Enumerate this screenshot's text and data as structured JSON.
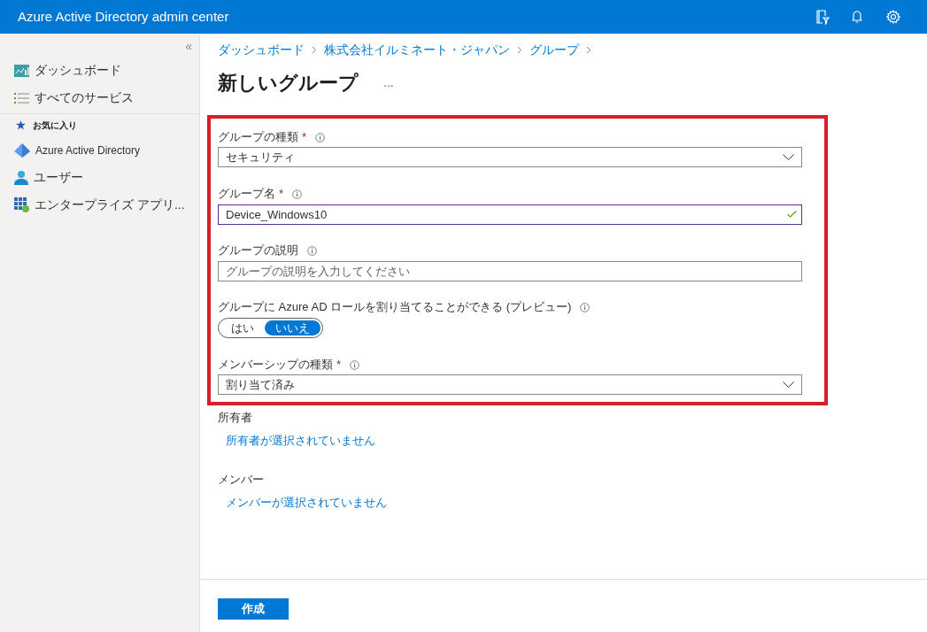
{
  "header": {
    "title": "Azure Active Directory admin center"
  },
  "sidebar": {
    "collapse": "«",
    "items": [
      {
        "kind": "item",
        "label": "ダッシュボード"
      },
      {
        "kind": "item",
        "label": "すべてのサービス"
      },
      {
        "kind": "section",
        "label": "お気に入り"
      },
      {
        "kind": "item",
        "label": "Azure Active Directory"
      },
      {
        "kind": "item",
        "label": "ユーザー"
      },
      {
        "kind": "item",
        "label": "エンタープライズ アプリ..."
      }
    ]
  },
  "breadcrumb": [
    "ダッシュボード",
    "株式会社イルミネート・ジャパン",
    "グループ"
  ],
  "page_title": "新しいグループ",
  "more": "...",
  "form": [
    {
      "kind": "dropdown",
      "label": "グループの種類",
      "required_mark": "*",
      "value": "セキュリティ"
    },
    {
      "kind": "text",
      "label": "グループ名",
      "required_mark": "*",
      "value": "Device_Windows10",
      "valid": true
    },
    {
      "kind": "text",
      "label": "グループの説明",
      "placeholder": "グループの説明を入力してください",
      "valid": false
    },
    {
      "kind": "toggle",
      "label": "グループに Azure AD ロールを割り当てることができる (プレビュー)",
      "options": [
        {
          "label": "はい",
          "selected": false
        },
        {
          "label": "いいえ",
          "selected": true
        }
      ]
    },
    {
      "kind": "dropdown",
      "label": "メンバーシップの種類",
      "required_mark": "*",
      "value": "割り当て済み"
    }
  ],
  "sections": [
    {
      "label": "所有者",
      "link": "所有者が選択されていません"
    },
    {
      "label": "メンバー",
      "link": "メンバーが選択されていません"
    }
  ],
  "submit": "作成"
}
